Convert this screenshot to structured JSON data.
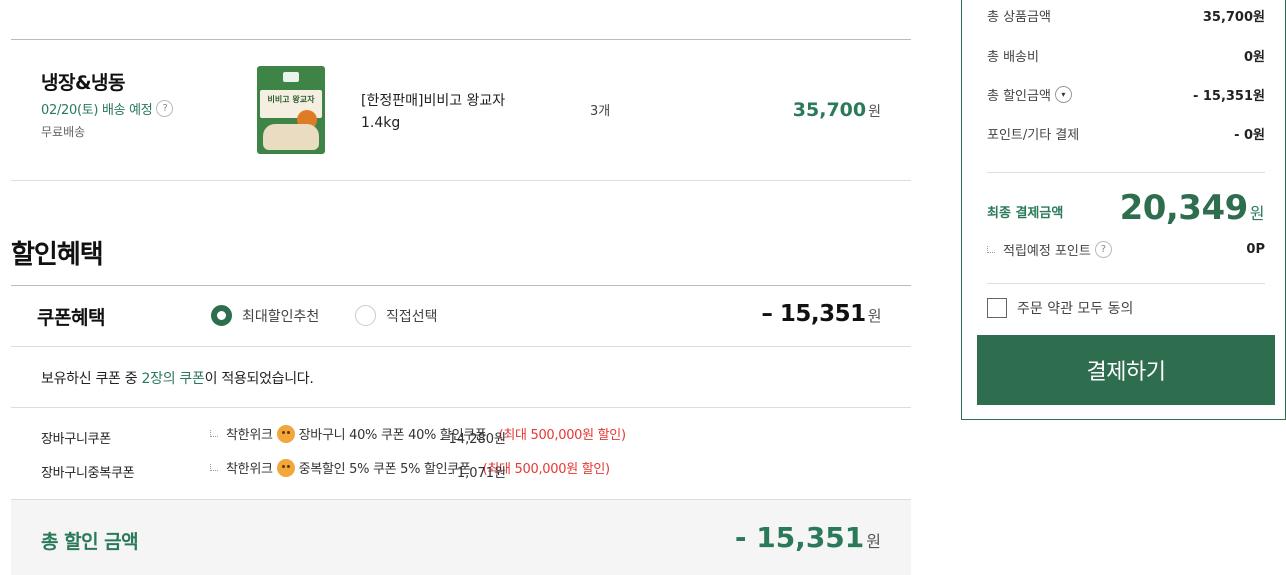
{
  "order": {
    "category": "냉장&냉동",
    "delivery_date": "02/20(토) 배송 예정",
    "help_icon": "?",
    "shipping_type": "무료배송",
    "product": {
      "name": "[한정판매]비비고 왕교자 1.4kg",
      "thumb_text": "비비고 왕교자",
      "quantity": "3개",
      "price": "35,700",
      "currency": "원"
    }
  },
  "discount": {
    "section_title": "할인혜택",
    "coupon_label": "쿠폰혜택",
    "options": [
      {
        "label": "최대할인추천",
        "selected": true
      },
      {
        "label": "직접선택",
        "selected": false
      }
    ],
    "coupon_total_sign": "–",
    "coupon_total": "15,351",
    "currency": "원",
    "applied_msg_pre": "보유하신 쿠폰 중 ",
    "applied_msg_hl": "2장의 쿠폰",
    "applied_msg_post": "이 적용되었습니다.",
    "coupons": [
      {
        "name": "장바구니쿠폰",
        "detail_a": "착한위크",
        "detail_b": "장바구니 40% 쿠폰 40% 할인쿠폰",
        "max": "(최대 500,000원 할인)",
        "amount": "- 14,280원"
      },
      {
        "name": "장바구니중복쿠폰",
        "detail_a": "착한위크",
        "detail_b": "중복할인 5% 쿠폰 5% 할인쿠폰",
        "max": "(최대 500,000원 할인)",
        "amount": "- 1,071원"
      }
    ],
    "total_label": "총 할인 금액",
    "total_amount": "- 15,351",
    "total_currency": "원"
  },
  "summary": {
    "rows": [
      {
        "label": "총 상품금액",
        "value": "35,700원"
      },
      {
        "label": "총 배송비",
        "value": "0원"
      },
      {
        "label": "총 할인금액",
        "value": "- 15,351원",
        "has_toggle": true
      },
      {
        "label": "포인트/기타 결제",
        "value": "- 0원"
      }
    ],
    "toggle_icon": "▾",
    "final_label": "최종 결제금액",
    "final_amount": "20,349",
    "final_currency": "원",
    "points_label": "적립예정 포인트",
    "points_value": "0P",
    "agree_label": "주문 약관 모두 동의",
    "pay_button": "결제하기"
  },
  "colors": {
    "accent": "#2e6e4f",
    "accent_text": "#2a7a5a",
    "max_discount_red": "#e53935"
  }
}
